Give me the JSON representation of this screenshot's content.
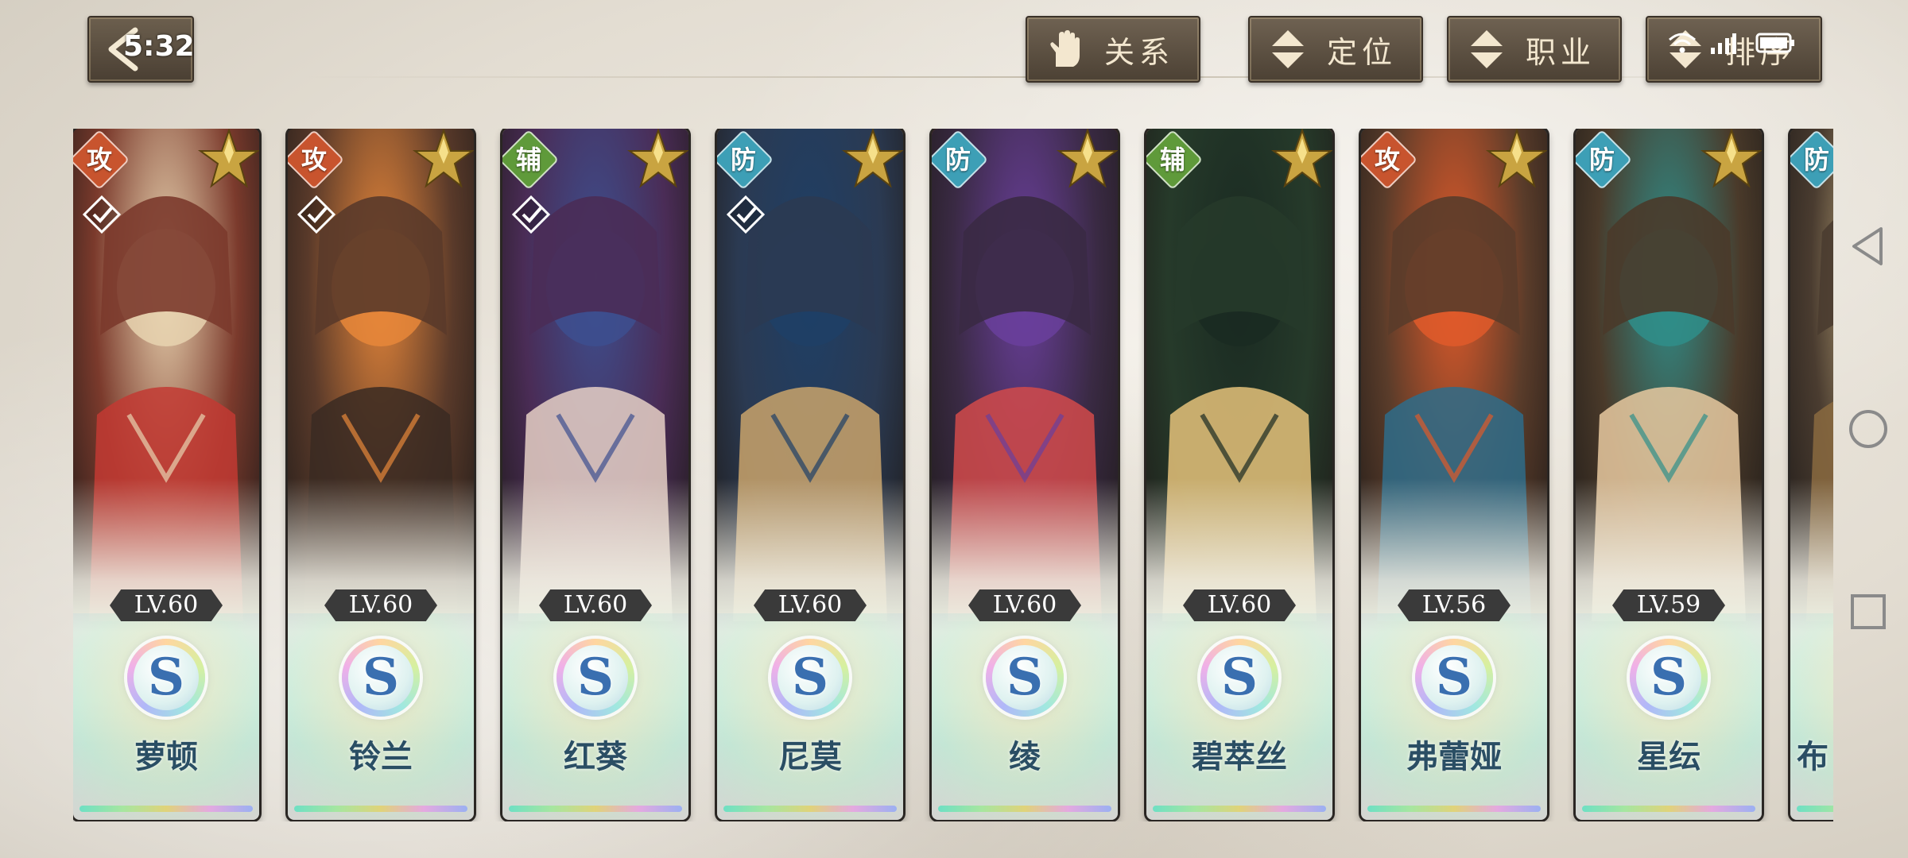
{
  "status_bar": {
    "time": "5:32"
  },
  "filters": [
    {
      "label": "关系",
      "icon": "hand-icon"
    },
    {
      "label": "定位",
      "icon": "sort-arrows-icon"
    },
    {
      "label": "职业",
      "icon": "sort-arrows-icon"
    },
    {
      "label": "排序",
      "icon": "sort-arrows-icon"
    }
  ],
  "colors": {
    "attack": "#c8542e",
    "support": "#5f9a3a",
    "defense": "#3d9fb6"
  },
  "characters": [
    {
      "role": "攻",
      "level": "LV.60",
      "grade": "S",
      "name": "萝顿"
    },
    {
      "role": "攻",
      "level": "LV.60",
      "grade": "S",
      "name": "铃兰"
    },
    {
      "role": "辅",
      "level": "LV.60",
      "grade": "S",
      "name": "红葵"
    },
    {
      "role": "防",
      "level": "LV.60",
      "grade": "S",
      "name": "尼莫"
    },
    {
      "role": "防",
      "level": "LV.60",
      "grade": "S",
      "name": "绫"
    },
    {
      "role": "辅",
      "level": "LV.60",
      "grade": "S",
      "name": "碧萃丝"
    },
    {
      "role": "攻",
      "level": "LV.56",
      "grade": "S",
      "name": "弗蕾娅"
    },
    {
      "role": "防",
      "level": "LV.59",
      "grade": "S",
      "name": "星纭"
    },
    {
      "role": "防",
      "level": "",
      "grade": "",
      "name": "布"
    }
  ]
}
